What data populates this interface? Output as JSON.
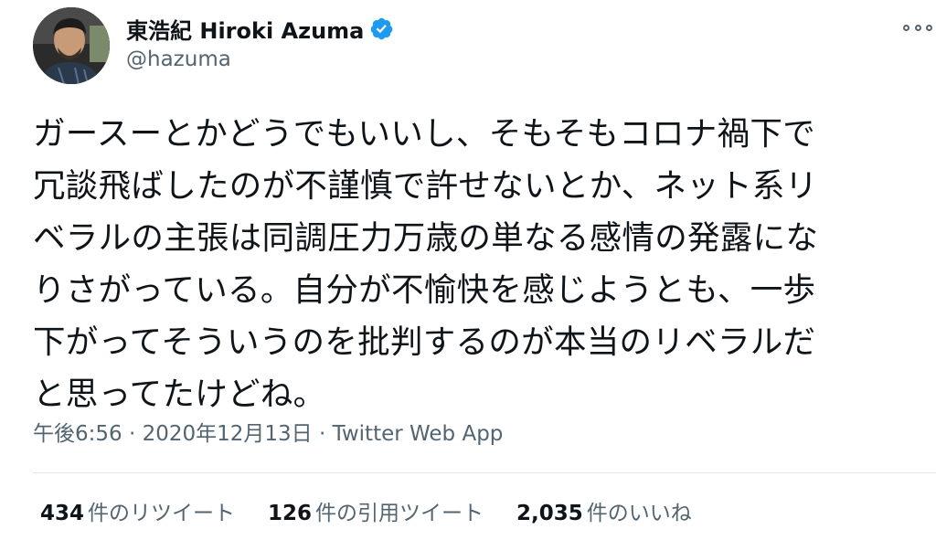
{
  "author": {
    "display_name": "東浩紀 Hiroki Azuma",
    "handle": "@hazuma",
    "verified": true,
    "avatar_icon": "profile-photo"
  },
  "tweet": {
    "lines": [
      "ガースーとかどうでもいいし、そもそもコロナ禍下で",
      "冗談飛ばしたのが不謹慎で許せないとか、ネット系リ",
      "ベラルの主張は同調圧力万歳の単なる感情の発露にな",
      "りさがっている。自分が不愉快を感じようとも、一歩",
      "下がってそういうのを批判するのが本当のリベラルだ",
      "と思ってたけどね。"
    ]
  },
  "meta": {
    "time": "午後6:56",
    "separator1": " · ",
    "date": "2020年12月13日",
    "separator2": " · ",
    "source": "Twitter Web App"
  },
  "stats": {
    "retweets_count": "434",
    "retweets_label": "件のリツイート",
    "quotes_count": "126",
    "quotes_label": "件の引用ツイート",
    "likes_count": "2,035",
    "likes_label": "件のいいね"
  },
  "colors": {
    "verified_badge": "#1d9bf0",
    "secondary_text": "#536471",
    "primary_text": "#0f1419"
  }
}
